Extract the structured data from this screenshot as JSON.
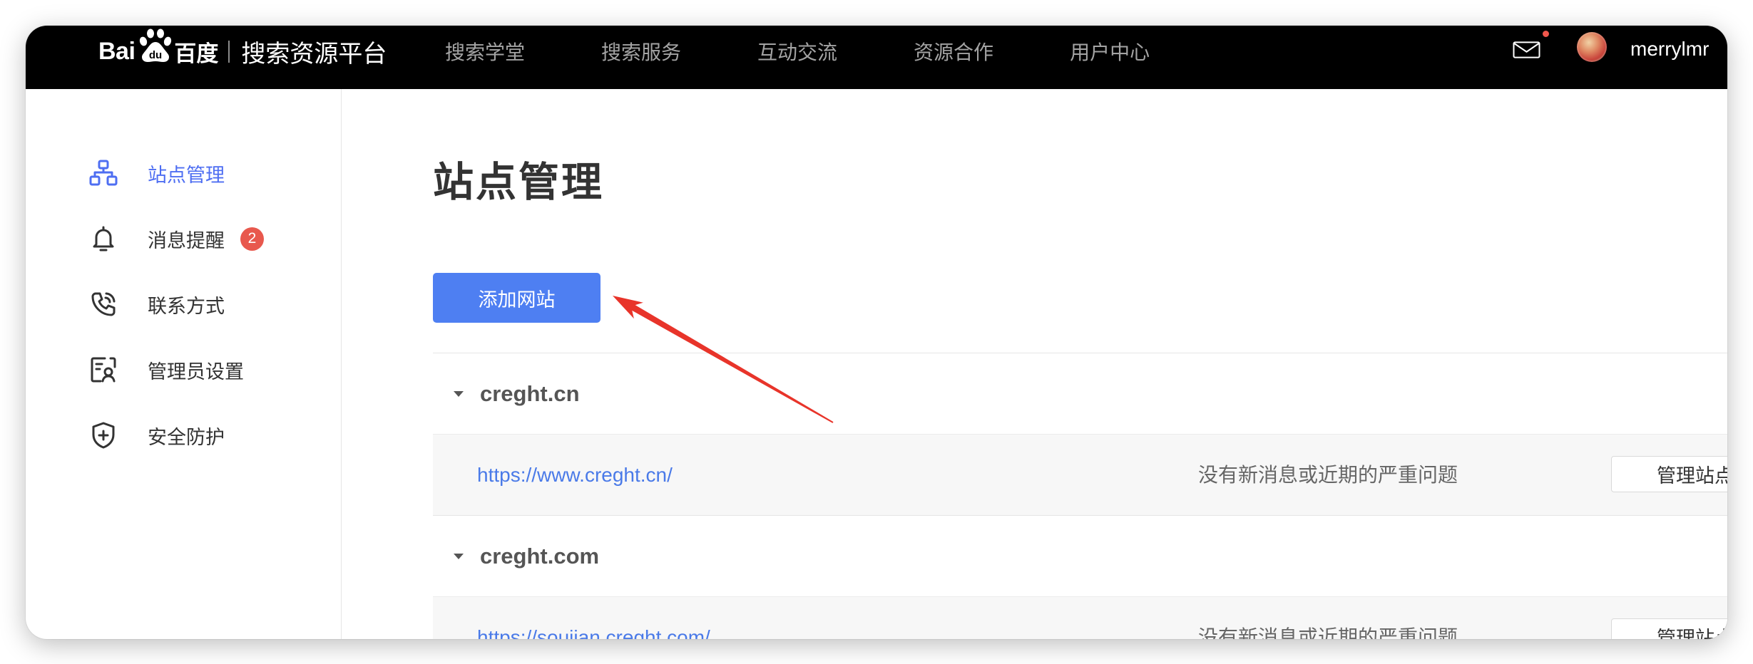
{
  "header": {
    "logo": {
      "bai": "Bai",
      "du": "du",
      "baidu_cn": "百度",
      "platform": "搜索资源平台"
    },
    "nav": [
      "搜索学堂",
      "搜索服务",
      "互动交流",
      "资源合作",
      "用户中心"
    ],
    "mail": {
      "icon": "mail-icon",
      "unread_dot": true
    },
    "username": "merrylmr"
  },
  "sidebar": {
    "items": [
      {
        "label": "站点管理",
        "icon": "sitemap-icon",
        "active": true
      },
      {
        "label": "消息提醒",
        "icon": "bell-icon",
        "badge": "2"
      },
      {
        "label": "联系方式",
        "icon": "phone-icon"
      },
      {
        "label": "管理员设置",
        "icon": "admin-settings-icon"
      },
      {
        "label": "安全防护",
        "icon": "shield-icon"
      }
    ]
  },
  "main": {
    "title": "站点管理",
    "add_button": "添加网站",
    "sites": [
      {
        "domain": "creght.cn",
        "url": "https://www.creght.cn/",
        "status": "没有新消息或近期的严重问题",
        "manage_label": "管理站点"
      },
      {
        "domain": "creght.com",
        "url": "https://soujian.creght.com/",
        "status": "没有新消息或近期的严重问题",
        "manage_label": "管理站点"
      }
    ]
  },
  "colors": {
    "topbar": "#000000",
    "accent": "#4e6ef2",
    "button": "#4e7ff2",
    "link": "#4a7ae8",
    "badge": "#e8584d",
    "unread_dot": "#f0574c",
    "annotation_arrow": "#e8342a"
  }
}
